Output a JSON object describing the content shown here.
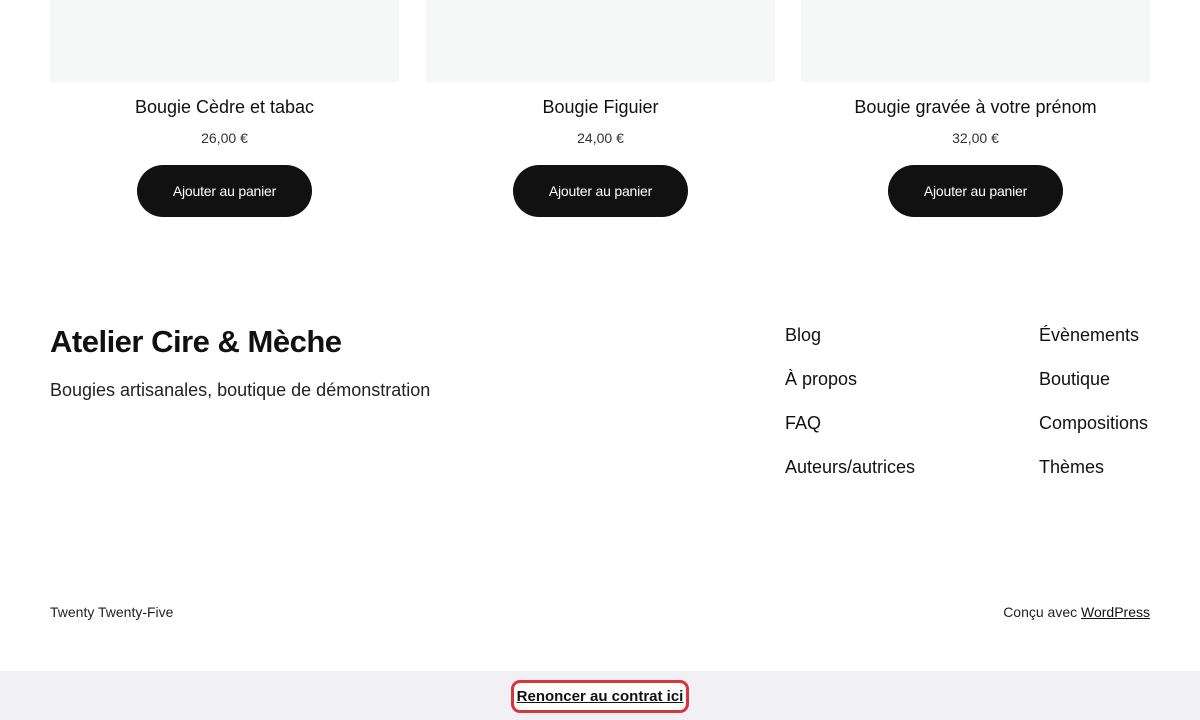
{
  "products": [
    {
      "title": "Bougie Cèdre et tabac",
      "price": "26,00 €",
      "button_label": "Ajouter au panier"
    },
    {
      "title": "Bougie Figuier",
      "price": "24,00 €",
      "button_label": "Ajouter au panier"
    },
    {
      "title": "Bougie gravée à votre prénom",
      "price": "32,00 €",
      "button_label": "Ajouter au panier"
    }
  ],
  "footer": {
    "site_title": "Atelier Cire & Mèche",
    "tagline": "Bougies artisanales, boutique de démonstration",
    "nav_col1": [
      "Blog",
      "À propos",
      "FAQ",
      "Auteurs/autrices"
    ],
    "nav_col2": [
      "Évènements",
      "Boutique",
      "Compositions",
      "Thèmes"
    ],
    "theme_credit": "Twenty Twenty-Five",
    "designed_with": "Conçu avec",
    "wordpress_link": "WordPress"
  },
  "consent": {
    "withdraw_label": "Renoncer au contrat ici"
  },
  "colors": {
    "button_bg": "#111111",
    "highlight_border": "#d63638",
    "consent_bar_bg": "#f1f1f5"
  }
}
